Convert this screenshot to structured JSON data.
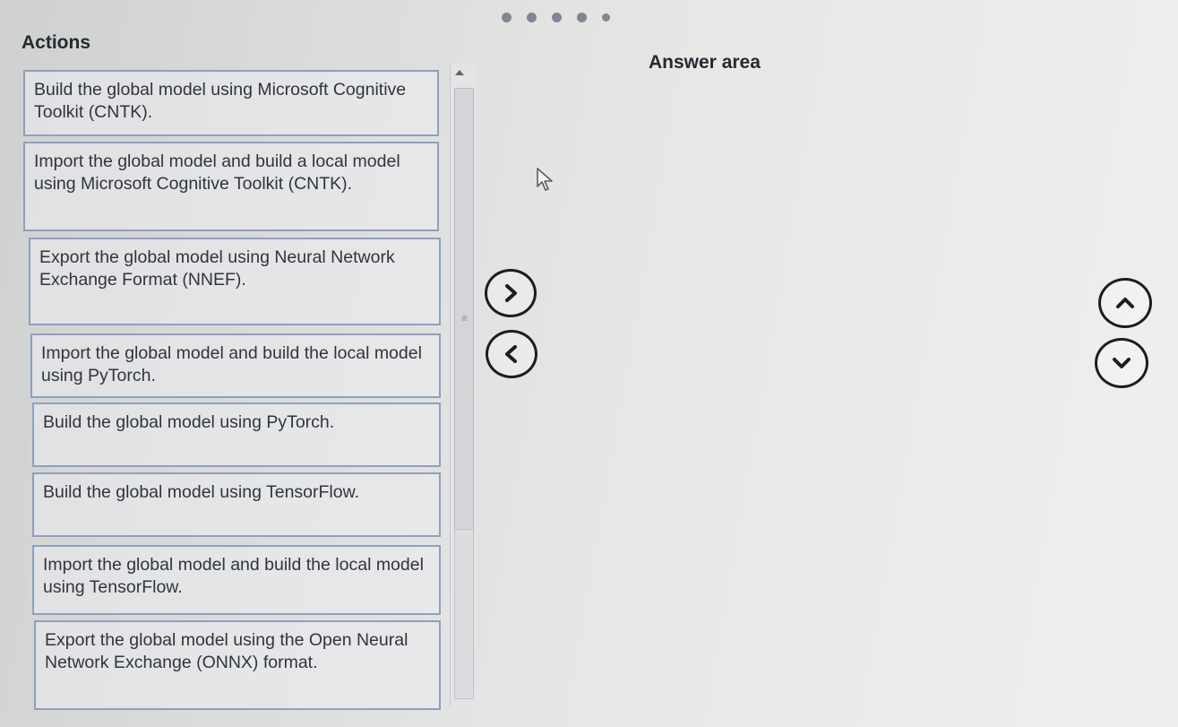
{
  "header": {
    "actions_title": "Actions",
    "answer_title": "Answer area"
  },
  "actions": [
    {
      "text": "Build the global model using Microsoft Cognitive Toolkit (CNTK)."
    },
    {
      "text": "Import the global model and build a local model using Microsoft Cognitive Toolkit (CNTK)."
    },
    {
      "text": "Export the global model using Neural Network Exchange Format (NNEF)."
    },
    {
      "text": "Import the global model and build the local model using PyTorch."
    },
    {
      "text": "Build the global model using PyTorch."
    },
    {
      "text": "Build the global model using TensorFlow."
    },
    {
      "text": "Import the global model and build the local model using TensorFlow."
    },
    {
      "text": "Export the global model using the Open Neural Network Exchange (ONNX) format."
    }
  ],
  "controls": {
    "move_right_icon": "chevron-right-icon",
    "move_left_icon": "chevron-left-icon",
    "move_up_icon": "chevron-up-icon",
    "move_down_icon": "chevron-down-icon"
  },
  "colors": {
    "item_border": "#8ea0bf",
    "button_stroke": "#1b1d20"
  }
}
